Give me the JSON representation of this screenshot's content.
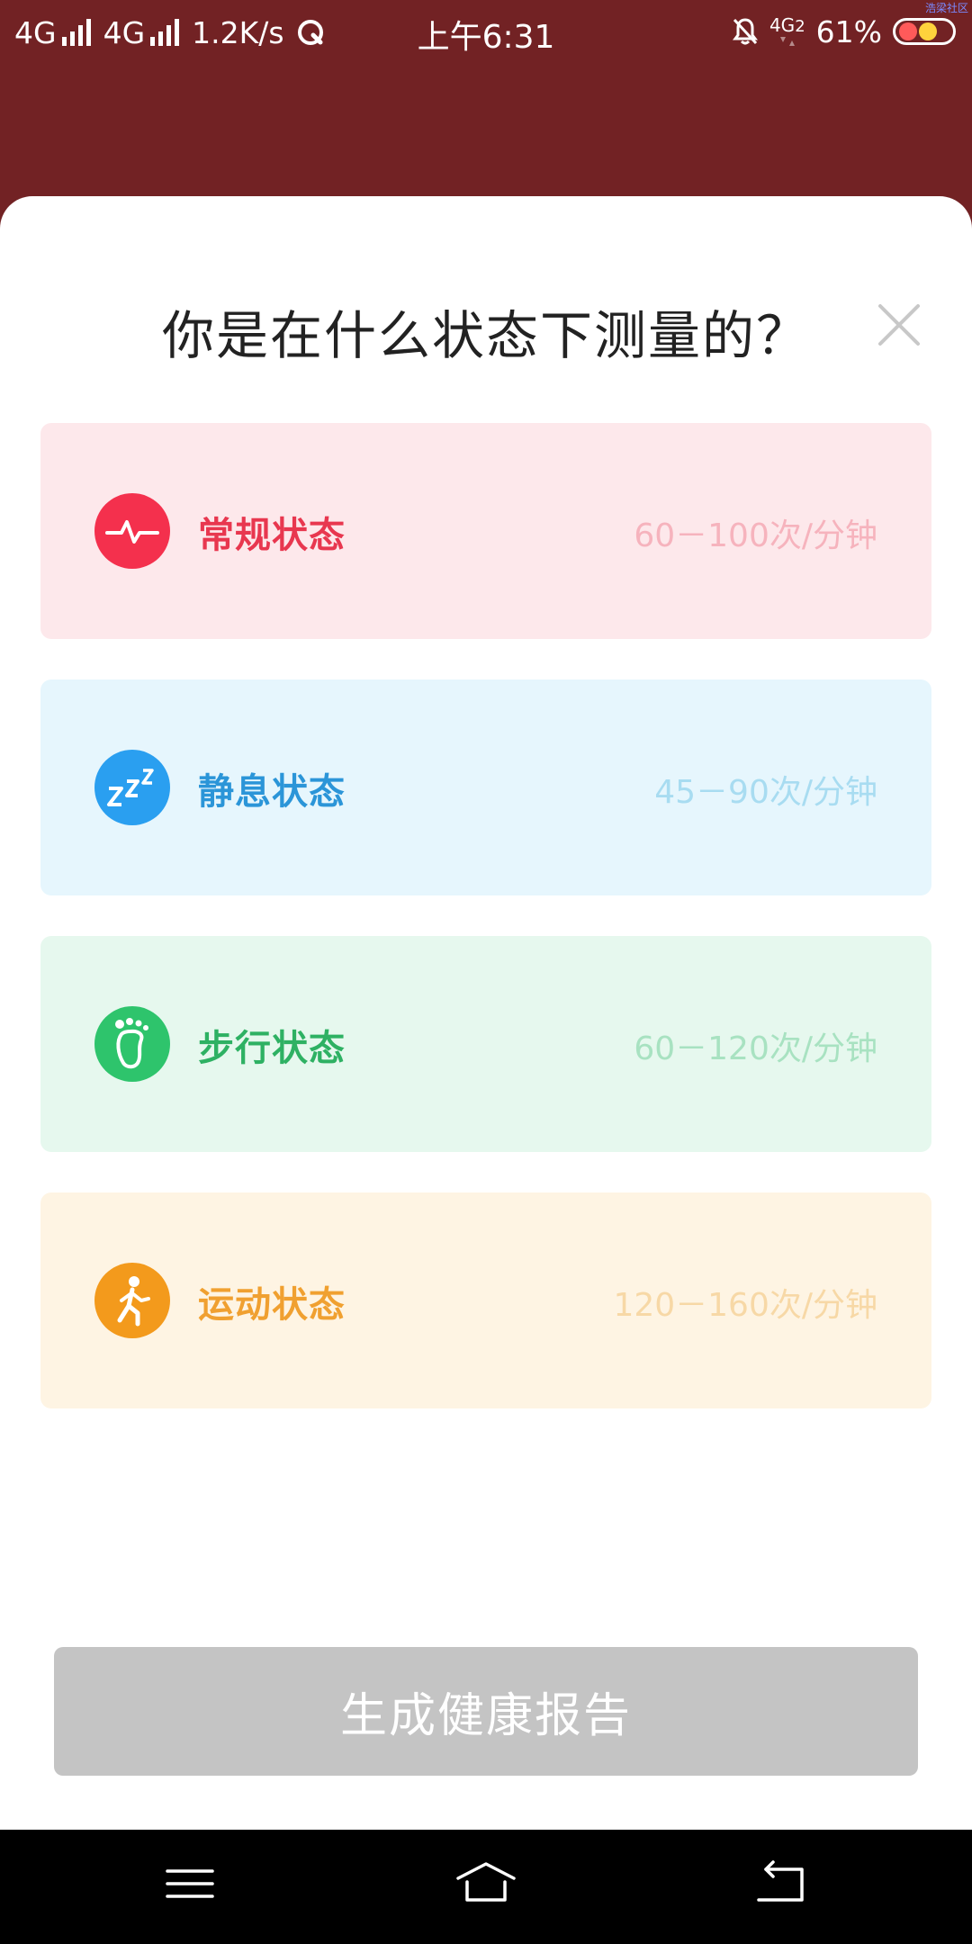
{
  "status_bar": {
    "network1": "4G",
    "network2": "4G",
    "speed": "1.2K/s",
    "time": "上午6:31",
    "network3": "4G",
    "network3_sub": "2",
    "battery": "61%",
    "corner_text": "浩梁社区"
  },
  "dialog": {
    "title": "你是在什么状态下测量的？",
    "options": [
      {
        "label": "常规状态",
        "range": "60－100次/分钟",
        "icon": "heartbeat-icon",
        "color": "#f4304d"
      },
      {
        "label": "静息状态",
        "range": "45－90次/分钟",
        "icon": "sleep-zzz-icon",
        "color": "#2a9ff0"
      },
      {
        "label": "步行状态",
        "range": "60－120次/分钟",
        "icon": "footprint-icon",
        "color": "#2ec46c"
      },
      {
        "label": "运动状态",
        "range": "120－160次/分钟",
        "icon": "running-person-icon",
        "color": "#f39a1c"
      }
    ],
    "generate_button": "生成健康报告"
  },
  "colors": {
    "header_bg": "#722224",
    "button_disabled": "#c4c4c4"
  }
}
